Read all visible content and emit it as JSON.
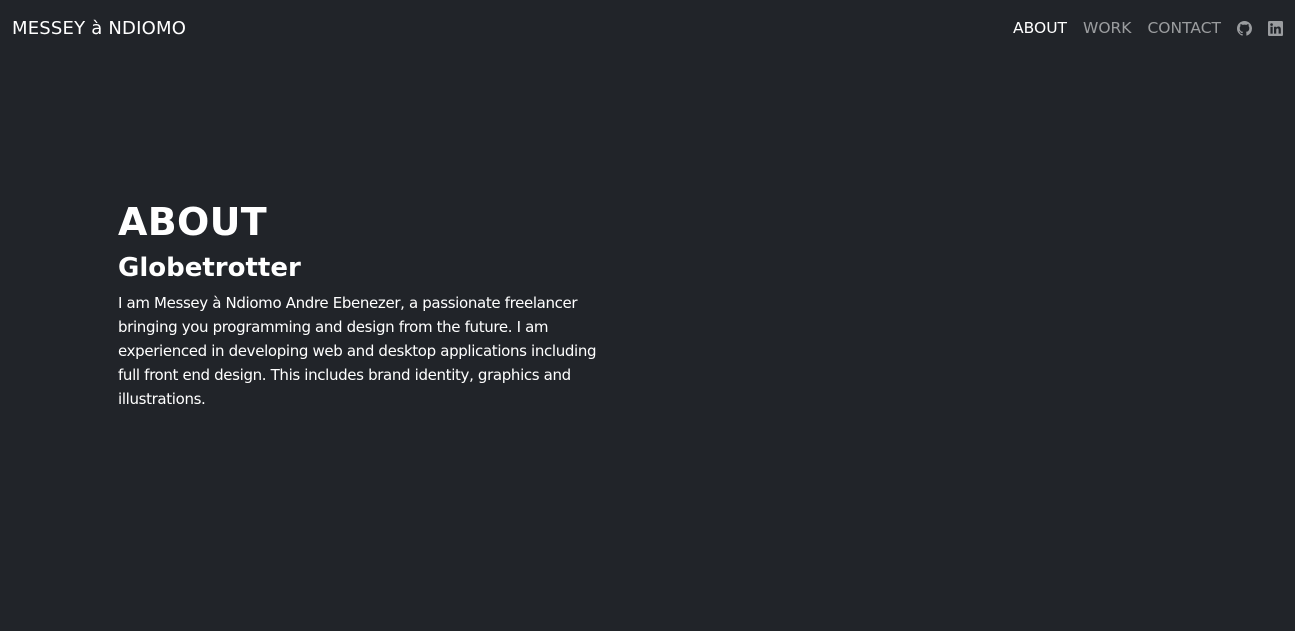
{
  "navbar": {
    "brand": "MESSEY à NDIOMO",
    "links": [
      {
        "label": "ABOUT",
        "active": true
      },
      {
        "label": "WORK",
        "active": false
      },
      {
        "label": "CONTACT",
        "active": false
      }
    ],
    "icons": [
      "github-icon",
      "linkedin-icon"
    ]
  },
  "about": {
    "title": "ABOUT",
    "subtitle": "Globetrotter",
    "text": "I am Messey à Ndiomo Andre Ebenezer, a passionate freelancer bringing you programming and design from the future. I am experienced in developing web and desktop applications including full front end design. This includes brand identity, graphics and illustrations."
  },
  "colors": {
    "background": "#212429",
    "text": "#ffffff",
    "nav_inactive": "#8c8e91"
  }
}
